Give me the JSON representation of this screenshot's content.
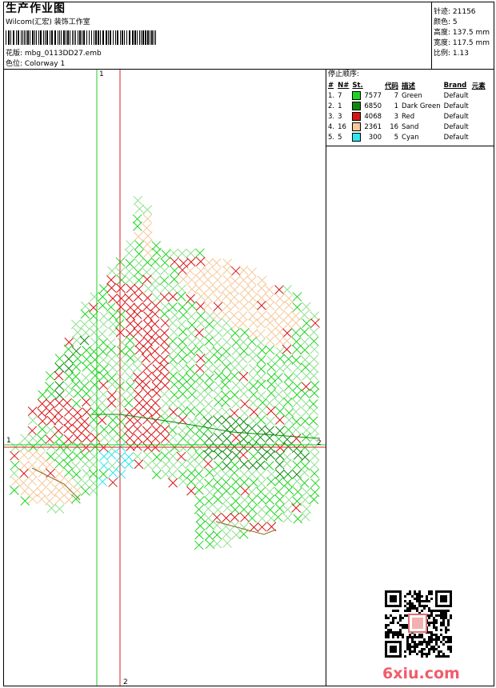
{
  "header": {
    "title": "生产作业图",
    "company": "Wilcom(汇宏) 装饰工作室",
    "design_line": "花版: mbg_0113DD27.emb",
    "colorway_line": "色位: Colorway 1"
  },
  "stats": {
    "stitches": "针迹: 21156",
    "colors": "颜色: 5",
    "height": "高度: 137.5 mm",
    "width": "宽度: 117.5 mm",
    "scale": "比例: 1.13"
  },
  "legend": {
    "title": "停止顺序:",
    "headers": [
      "#",
      "N#",
      "St.",
      "代码",
      "描述",
      "Brand",
      "元素"
    ],
    "rows": [
      {
        "idx": "1.",
        "n": "7",
        "color": "#1fd41f",
        "st": "7577",
        "code": "7",
        "desc": "Green",
        "brand": "Default"
      },
      {
        "idx": "2.",
        "n": "1",
        "color": "#0b8a0b",
        "st": "6850",
        "code": "1",
        "desc": "Dark Green",
        "brand": "Default"
      },
      {
        "idx": "3.",
        "n": "3",
        "color": "#d61414",
        "st": "4068",
        "code": "3",
        "desc": "Red",
        "brand": "Default"
      },
      {
        "idx": "4.",
        "n": "16",
        "color": "#f5c99a",
        "st": "2361",
        "code": "16",
        "desc": "Sand",
        "brand": "Default"
      },
      {
        "idx": "5.",
        "n": "5",
        "color": "#2ee6ee",
        "st": "300",
        "code": "5",
        "desc": "Cyan",
        "brand": "Default"
      }
    ]
  },
  "axes": {
    "top_label": "1",
    "left_label": "1",
    "right_label": "2",
    "bottom_label": "2"
  },
  "watermark": "6xiu.com"
}
